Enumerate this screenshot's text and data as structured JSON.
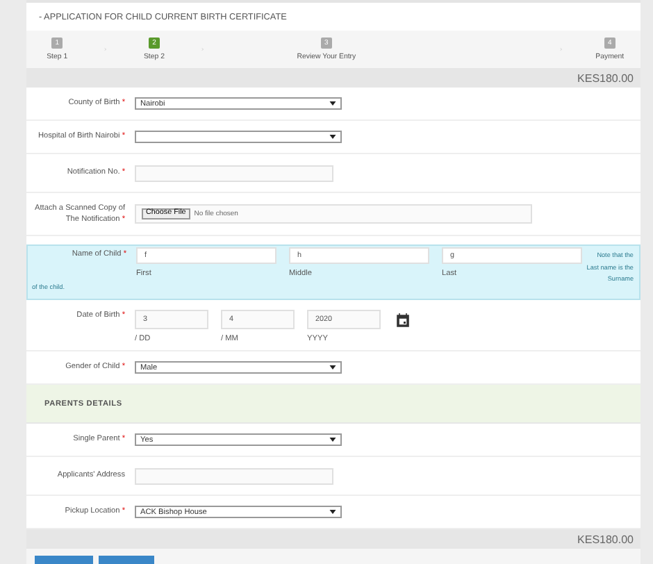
{
  "title": "- APPLICATION FOR CHILD CURRENT BIRTH CERTIFICATE",
  "steps": [
    {
      "number": "1",
      "label": "Step 1",
      "selected": false
    },
    {
      "number": "2",
      "label": "Step 2",
      "selected": true
    },
    {
      "number": "3",
      "label": "Review Your Entry",
      "selected": false
    },
    {
      "number": "4",
      "label": "Payment",
      "selected": false
    }
  ],
  "fee_top": "KES180.00",
  "fields": [
    {
      "kind": "select",
      "label": "County of Birth",
      "required_mark": "*",
      "value": "Nairobi"
    },
    {
      "kind": "select",
      "label": "Hospital of Birth Nairobi",
      "required_mark": "*"
    },
    {
      "kind": "text",
      "label": "Notification No.",
      "required_mark": "*"
    },
    {
      "kind": "file",
      "label": "Attach a Scanned Copy of The Notification",
      "required_mark": "*",
      "button": "Choose File",
      "status": "No file chosen"
    },
    {
      "kind": "name",
      "label": "Name of Child",
      "required_mark": "*",
      "parts": [
        {
          "value": "f",
          "caption": "First"
        },
        {
          "value": "h",
          "caption": "Middle"
        },
        {
          "value": "g",
          "caption": "Last"
        }
      ],
      "note": "Note that the Last name is the Surname",
      "note_tail": "of the child."
    },
    {
      "kind": "date",
      "label": "Date of Birth",
      "required_mark": "*",
      "parts": [
        {
          "value": "3",
          "caption": "/ DD"
        },
        {
          "value": "4",
          "caption": "/ MM"
        },
        {
          "value": "2020",
          "caption": "YYYY"
        }
      ]
    },
    {
      "kind": "select",
      "label": "Gender of Child",
      "required_mark": "*",
      "value": "Male"
    },
    {
      "kind": "section",
      "label": "PARENTS DETAILS"
    },
    {
      "kind": "select",
      "label": "Single Parent",
      "required_mark": "*",
      "value": "Yes"
    },
    {
      "kind": "text",
      "label": "Applicants' Address"
    },
    {
      "kind": "select",
      "label": "Pickup Location",
      "required_mark": "*",
      "value": "ACK Bishop House"
    }
  ],
  "fee_bottom": "KES180.00"
}
